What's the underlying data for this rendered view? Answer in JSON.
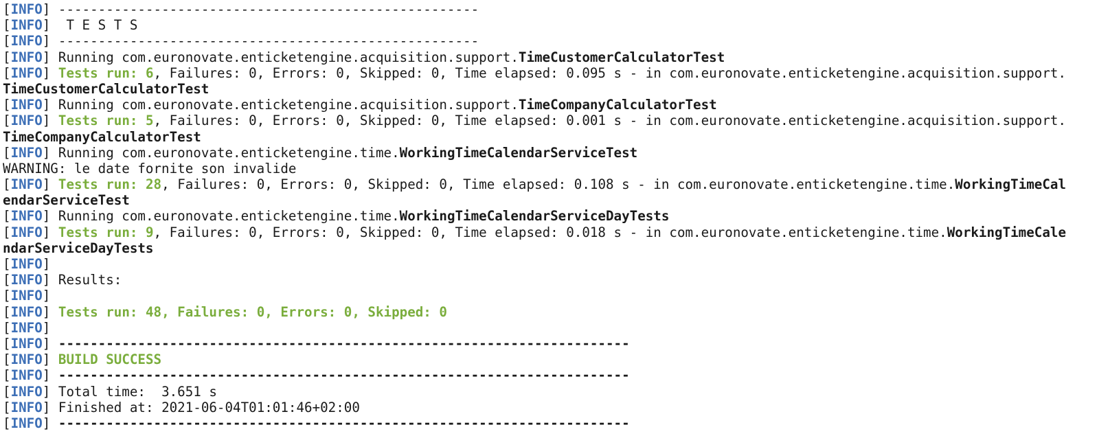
{
  "terminal": {
    "tag": "INFO",
    "lines": [
      {
        "tagged": true,
        "segments": [
          {
            "t": " -----------------------------------------------------",
            "s": "n"
          }
        ]
      },
      {
        "tagged": true,
        "segments": [
          {
            "t": "  T E S T S",
            "s": "n"
          }
        ]
      },
      {
        "tagged": true,
        "segments": [
          {
            "t": " -----------------------------------------------------",
            "s": "n"
          }
        ]
      },
      {
        "tagged": true,
        "segments": [
          {
            "t": " Running com.euronovate.enticketengine.acquisition.support.",
            "s": "n"
          },
          {
            "t": "TimeCustomerCalculatorTest",
            "s": "b"
          }
        ]
      },
      {
        "tagged": true,
        "segments": [
          {
            "t": " ",
            "s": "n"
          },
          {
            "t": "Tests run: 6",
            "s": "g"
          },
          {
            "t": ", Failures: 0, Errors: 0, Skipped: 0, Time elapsed: 0.095 s - in com.euronovate.enticketengine.acquisition.support.",
            "s": "n"
          }
        ]
      },
      {
        "tagged": false,
        "segments": [
          {
            "t": "TimeCustomerCalculatorTest",
            "s": "b"
          }
        ]
      },
      {
        "tagged": true,
        "segments": [
          {
            "t": " Running com.euronovate.enticketengine.acquisition.support.",
            "s": "n"
          },
          {
            "t": "TimeCompanyCalculatorTest",
            "s": "b"
          }
        ]
      },
      {
        "tagged": true,
        "segments": [
          {
            "t": " ",
            "s": "n"
          },
          {
            "t": "Tests run: 5",
            "s": "g"
          },
          {
            "t": ", Failures: 0, Errors: 0, Skipped: 0, Time elapsed: 0.001 s - in com.euronovate.enticketengine.acquisition.support.",
            "s": "n"
          }
        ]
      },
      {
        "tagged": false,
        "segments": [
          {
            "t": "TimeCompanyCalculatorTest",
            "s": "b"
          }
        ]
      },
      {
        "tagged": true,
        "segments": [
          {
            "t": " Running com.euronovate.enticketengine.time.",
            "s": "n"
          },
          {
            "t": "WorkingTimeCalendarServiceTest",
            "s": "b"
          }
        ]
      },
      {
        "tagged": false,
        "segments": [
          {
            "t": "WARNING: le date fornite son invalide",
            "s": "n"
          }
        ]
      },
      {
        "tagged": true,
        "segments": [
          {
            "t": " ",
            "s": "n"
          },
          {
            "t": "Tests run: 28",
            "s": "g"
          },
          {
            "t": ", Failures: 0, Errors: 0, Skipped: 0, Time elapsed: 0.108 s - in com.euronovate.enticketengine.time.",
            "s": "n"
          },
          {
            "t": "WorkingTimeCal",
            "s": "b"
          }
        ]
      },
      {
        "tagged": false,
        "segments": [
          {
            "t": "endarServiceTest",
            "s": "b"
          }
        ]
      },
      {
        "tagged": true,
        "segments": [
          {
            "t": " Running com.euronovate.enticketengine.time.",
            "s": "n"
          },
          {
            "t": "WorkingTimeCalendarServiceDayTests",
            "s": "b"
          }
        ]
      },
      {
        "tagged": true,
        "segments": [
          {
            "t": " ",
            "s": "n"
          },
          {
            "t": "Tests run: 9",
            "s": "g"
          },
          {
            "t": ", Failures: 0, Errors: 0, Skipped: 0, Time elapsed: 0.018 s - in com.euronovate.enticketengine.time.",
            "s": "n"
          },
          {
            "t": "WorkingTimeCale",
            "s": "b"
          }
        ]
      },
      {
        "tagged": false,
        "segments": [
          {
            "t": "ndarServiceDayTests",
            "s": "b"
          }
        ]
      },
      {
        "tagged": true,
        "segments": []
      },
      {
        "tagged": true,
        "segments": [
          {
            "t": " Results:",
            "s": "n"
          }
        ]
      },
      {
        "tagged": true,
        "segments": []
      },
      {
        "tagged": true,
        "segments": [
          {
            "t": " ",
            "s": "n"
          },
          {
            "t": "Tests run: 48, Failures: 0, Errors: 0, Skipped: 0",
            "s": "g"
          }
        ]
      },
      {
        "tagged": true,
        "segments": []
      },
      {
        "tagged": true,
        "segments": [
          {
            "t": " ------------------------------------------------------------------------",
            "s": "b"
          }
        ]
      },
      {
        "tagged": true,
        "segments": [
          {
            "t": " ",
            "s": "n"
          },
          {
            "t": "BUILD SUCCESS",
            "s": "g"
          }
        ]
      },
      {
        "tagged": true,
        "segments": [
          {
            "t": " ------------------------------------------------------------------------",
            "s": "b"
          }
        ]
      },
      {
        "tagged": true,
        "segments": [
          {
            "t": " Total time:  3.651 s",
            "s": "n"
          }
        ]
      },
      {
        "tagged": true,
        "segments": [
          {
            "t": " Finished at: 2021-06-04T01:01:46+02:00",
            "s": "n"
          }
        ]
      },
      {
        "tagged": true,
        "segments": [
          {
            "t": " ------------------------------------------------------------------------",
            "s": "b"
          }
        ]
      }
    ]
  },
  "colors": {
    "background": "#ffffff",
    "text": "#1a1a1a",
    "info_tag": "#3d6fb6",
    "success_green": "#7aad3c",
    "cursor": "#e8a53c"
  }
}
